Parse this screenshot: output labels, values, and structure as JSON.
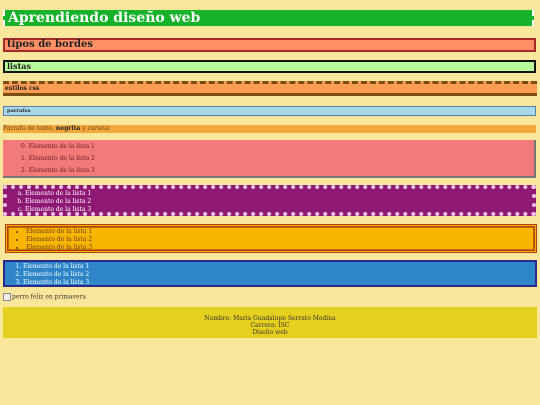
{
  "headings": {
    "h1": "Aprendiendo diseño web",
    "h2": "tipos de bordes",
    "h3": "listas",
    "h4": "estilos css",
    "h5": "parrafos"
  },
  "paragraph": {
    "plain": "Párrafo de texto, ",
    "bold": "negrita",
    "middle": " y ",
    "italic": "cursiva"
  },
  "lists": {
    "list1": [
      "Elemento de la lista 1",
      "Elemento de la lista 2",
      "Elemento de la lista 3"
    ],
    "list2": [
      "Elemento de la lista 1",
      "Elemento de la lista 2",
      "Elemento de la lista 3"
    ],
    "list3": [
      "Elemento de la lista 1",
      "Elemento de la lista 2",
      "Elemento de la lista 3"
    ],
    "list4": [
      "Elemento de la lista 1",
      "Elemento de la lista 2",
      "Elemento de la lista 3"
    ]
  },
  "image_alt": "perro feliz en primavera",
  "footer": {
    "line1": "Nombre: Maria Guadalupe Serrato Medina",
    "line2": "Carrera: ISC",
    "line3": "Diseño web"
  },
  "colors": {
    "background": "#fbe79c",
    "h1_bg": "#16b32a",
    "h2_bg": "#ff9066",
    "h3_bg": "#b8ff9c",
    "h4_bg": "#ff9d55",
    "h5_bg": "#a8d8e8",
    "list1_bg": "#f27a7a",
    "list2_bg": "#8e1874",
    "list3_bg": "#f7b500",
    "list4_bg": "#2e86c9",
    "footer_bg": "#e6d01e"
  }
}
